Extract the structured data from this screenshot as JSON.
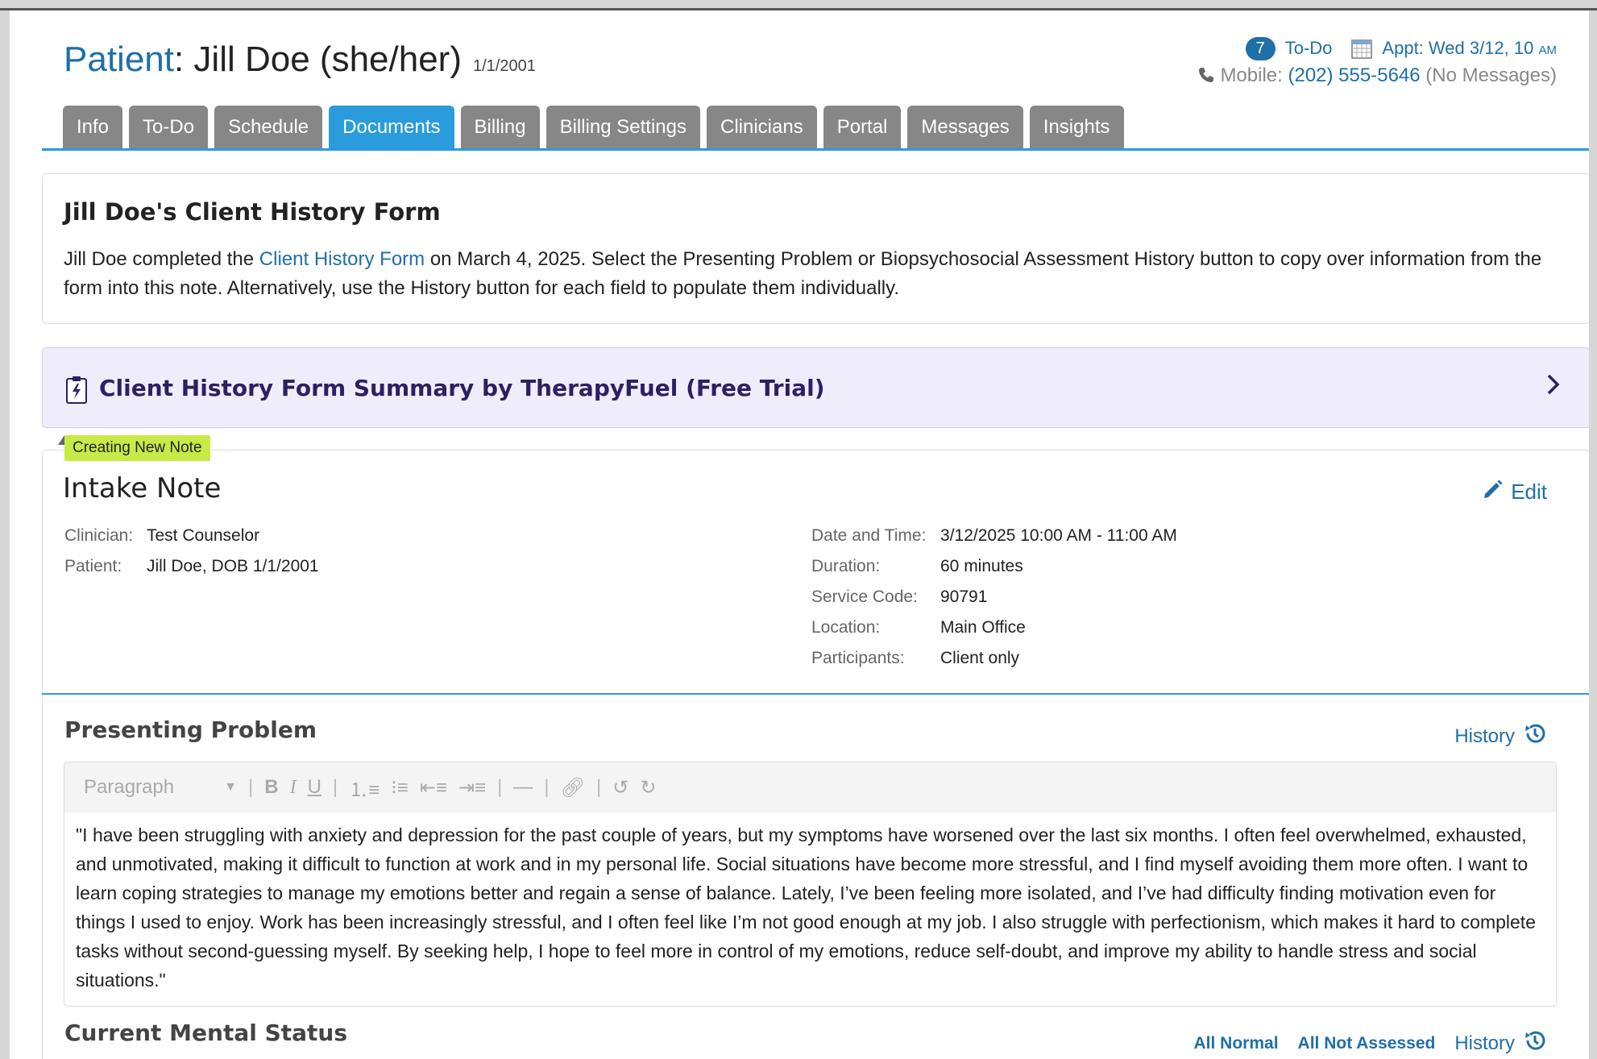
{
  "header": {
    "patient_label": "Patient",
    "patient_name": ": Jill Doe (she/her)",
    "dob": "1/1/2001",
    "todo_count": "7",
    "todo_label": "To-Do",
    "appt_label": "Appt: Wed 3/12, 10",
    "appt_suffix": "AM",
    "mobile_label": "Mobile:",
    "mobile_number": "(202) 555-5646",
    "mobile_note": "(No Messages)"
  },
  "tabs": [
    {
      "label": "Info"
    },
    {
      "label": "To-Do"
    },
    {
      "label": "Schedule"
    },
    {
      "label": "Documents",
      "active": true
    },
    {
      "label": "Billing"
    },
    {
      "label": "Billing Settings"
    },
    {
      "label": "Clinicians"
    },
    {
      "label": "Portal"
    },
    {
      "label": "Messages"
    },
    {
      "label": "Insights"
    }
  ],
  "form_card": {
    "title": "Jill Doe's Client History Form",
    "text_before_link": "Jill Doe completed the ",
    "link_text": "Client History Form",
    "text_after_link": " on March 4, 2025. Select the Presenting Problem or Biopsychosocial Assessment History button to copy over information from the form into this note. Alternatively, use the History button for each field to populate them individually."
  },
  "summary_card": {
    "title": "Client History Form Summary by TherapyFuel (Free Trial)"
  },
  "note": {
    "flag": "Creating New Note",
    "title": "Intake Note",
    "edit_label": "Edit",
    "clinician_label": "Clinician:",
    "clinician_value": "Test Counselor",
    "patient_label": "Patient:",
    "patient_value": "Jill Doe, DOB 1/1/2001",
    "datetime_label": "Date and Time:",
    "datetime_value": "3/12/2025 10:00 AM - 11:00 AM",
    "duration_label": "Duration:",
    "duration_value": "60 minutes",
    "service_label": "Service Code:",
    "service_value": "90791",
    "location_label": "Location:",
    "location_value": "Main Office",
    "participants_label": "Participants:",
    "participants_value": "Client only"
  },
  "presenting_problem": {
    "heading": "Presenting Problem",
    "history_label": "History",
    "toolbar_format": "Paragraph",
    "body": "\"I have been struggling with anxiety and depression for the past couple of years, but my symptoms have worsened over the last six months. I often feel overwhelmed, exhausted, and unmotivated, making it difficult to function at work and in my personal life. Social situations have become more stressful, and I find myself avoiding them more often. I want to learn coping strategies to manage my emotions better and regain a sense of balance. Lately, I’ve been feeling more isolated, and I’ve had difficulty finding motivation even for things I used to enjoy. Work has been increasingly stressful, and I often feel like I’m not good enough at my job. I also struggle with perfectionism, which makes it hard to complete tasks without second-guessing myself. By seeking help, I hope to feel more in control of my emotions, reduce self-doubt, and improve my ability to handle stress and social situations.\""
  },
  "mental_status": {
    "heading": "Current Mental Status",
    "all_normal": "All Normal",
    "all_not_assessed": "All Not Assessed",
    "history_label": "History"
  },
  "colors": {
    "accent": "#2a9bdc",
    "link": "#1f6fa8",
    "tab_inactive": "#878787",
    "summary_bg": "#efedfb",
    "flag": "#c7ea46"
  }
}
